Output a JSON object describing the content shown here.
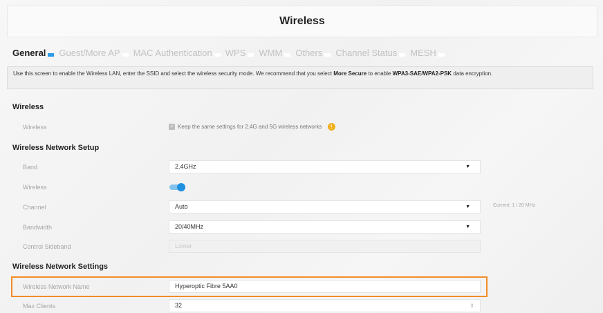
{
  "page": {
    "title": "Wireless"
  },
  "tabs": [
    {
      "label": "General",
      "active": true
    },
    {
      "label": "Guest/More AP",
      "active": false
    },
    {
      "label": "MAC Authentication",
      "active": false
    },
    {
      "label": "WPS",
      "active": false
    },
    {
      "label": "WMM",
      "active": false
    },
    {
      "label": "Others",
      "active": false
    },
    {
      "label": "Channel Status",
      "active": false
    },
    {
      "label": "MESH",
      "active": false
    }
  ],
  "intro": {
    "text_1": "Use this screen to enable the Wireless LAN, enter the SSID and select the wireless security mode. We recommend that you select ",
    "bold_1": "More Secure",
    "text_2": " to enable ",
    "bold_2": "WPA3-SAE/WPA2-PSK",
    "text_3": " data encryption."
  },
  "wireless_section": {
    "heading": "Wireless",
    "label": "Wireless",
    "checkbox_label": "Keep the same settings for 2.4G and 5G wireless networks",
    "info_icon": "!"
  },
  "setup": {
    "heading": "Wireless Network Setup",
    "band_label": "Band",
    "band_value": "2.4GHz",
    "wireless_label": "Wireless",
    "wireless_enabled": true,
    "channel_label": "Channel",
    "channel_value": "Auto",
    "channel_current": "Current: 1 / 20 MHz",
    "bandwidth_label": "Bandwidth",
    "bandwidth_value": "20/40MHz",
    "sideband_label": "Control Sideband",
    "sideband_value": "Lower",
    "dropdown_glyph": "▼"
  },
  "settings": {
    "heading": "Wireless Network Settings",
    "ssid_label": "Wireless Network Name",
    "ssid_value": "Hyperoptic Fibre 5AA0",
    "max_clients_label": "Max Clients",
    "max_clients_value": "32",
    "spinner_glyph": "⇕"
  },
  "colors": {
    "accent": "#2a9be6",
    "highlight": "#f28c28",
    "info": "#f2b01e"
  }
}
